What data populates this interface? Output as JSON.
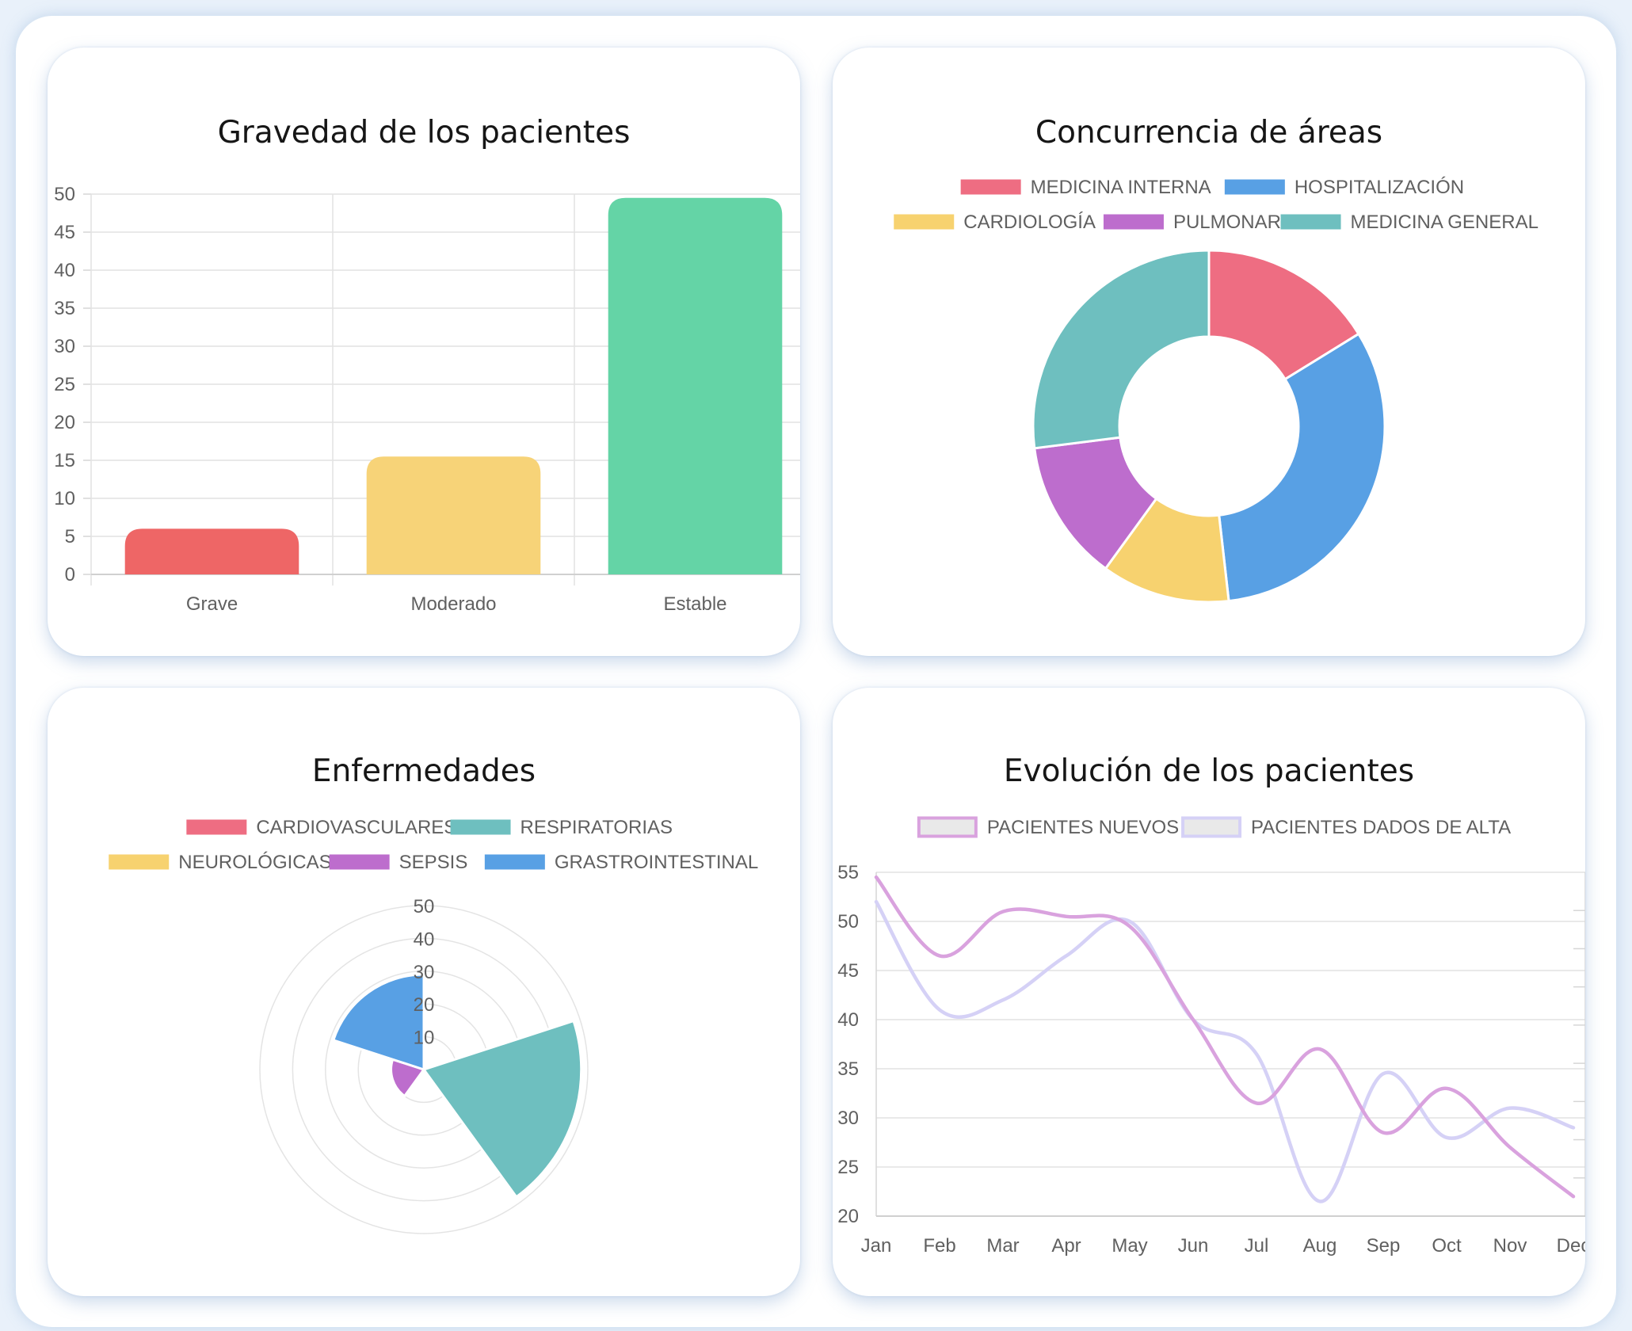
{
  "chart_data": [
    {
      "type": "bar",
      "title": "Gravedad de los pacientes",
      "categories": [
        "Grave",
        "Moderado",
        "Estable"
      ],
      "values": [
        6,
        15.5,
        49.5
      ],
      "colors": [
        "#ee6666",
        "#f7d378",
        "#64d4a6"
      ],
      "ylim": [
        0,
        50
      ],
      "yticks": [
        "0",
        "5",
        "10",
        "15",
        "20",
        "25",
        "30",
        "35",
        "40",
        "45",
        "50"
      ],
      "grid": true
    },
    {
      "type": "pie",
      "subtype": "doughnut",
      "title": "Concurrencia de áreas",
      "labels": [
        "MEDICINA INTERNA",
        "HOSPITALIZACIÓN",
        "CARDIOLOGÍA",
        "PULMONAR",
        "MEDICINA GENERAL"
      ],
      "values": [
        16.2,
        32.0,
        11.8,
        13.0,
        27.0
      ],
      "colors": [
        "#ee6d82",
        "#58a0e4",
        "#f7d26f",
        "#bd6dcd",
        "#6ebfbf"
      ],
      "legend": "top"
    },
    {
      "type": "polar-area",
      "title": "Enfermedades",
      "labels": [
        "CARDIOVASCULARES",
        "RESPIRATORIAS",
        "NEUROLÓGICAS",
        "SEPSIS",
        "GRASTROINTESTINAL"
      ],
      "values": [
        0,
        48,
        0,
        10,
        29
      ],
      "colors": [
        "#ee6d82",
        "#6ebfbf",
        "#f7d26f",
        "#bd6dcd",
        "#58a0e4"
      ],
      "rmax": 50,
      "rticks": [
        "10",
        "20",
        "30",
        "40",
        "50"
      ],
      "legend": "top"
    },
    {
      "type": "line",
      "title": "Evolución de los pacientes",
      "categories": [
        "Jan",
        "Feb",
        "Mar",
        "Apr",
        "May",
        "Jun",
        "Jul",
        "Aug",
        "Sep",
        "Oct",
        "Nov",
        "Dec"
      ],
      "series": [
        {
          "name": "PACIENTES NUEVOS",
          "color": "#d9a2de",
          "values": [
            54.5,
            46.5,
            51,
            50.5,
            49.5,
            40,
            31.5,
            37,
            28.5,
            33,
            27,
            22
          ]
        },
        {
          "name": "PACIENTES DADOS DE ALTA",
          "color": "#d5d1f6",
          "values": [
            52,
            41,
            42,
            46.5,
            50,
            40,
            36.5,
            21.5,
            34.5,
            28,
            31,
            29
          ]
        }
      ],
      "ylim": [
        20,
        55
      ],
      "yticks": [
        "20",
        "25",
        "30",
        "35",
        "40",
        "45",
        "50",
        "55"
      ],
      "legend": "top",
      "grid": true
    }
  ]
}
